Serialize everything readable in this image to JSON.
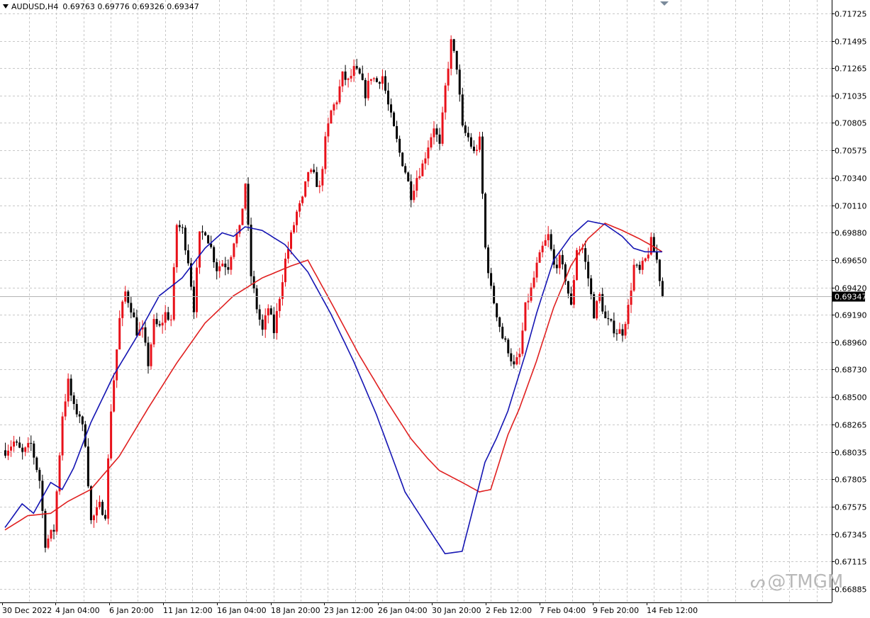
{
  "header": {
    "symbol": "AUDUSD,H4",
    "ohlc": "0.69763 0.69776 0.69326 0.69347"
  },
  "current_price_label": "0.69347",
  "watermark": "@TMGM",
  "icons": {
    "header_dropdown": "triangle-down-icon",
    "watermark_logo": "tmgm-logo-icon",
    "scroll_marker": "triangle-down-icon"
  },
  "colors": {
    "bull_candle": "#e8111a",
    "bear_candle": "#000000",
    "ma_fast": "#1515b3",
    "ma_slow": "#e02020",
    "grid": "#c8c8c8",
    "price_line": "#b4b4b4"
  },
  "chart_data": {
    "type": "candlestick",
    "symbol": "AUDUSD",
    "timeframe": "H4",
    "y_ticks": [
      "0.71725",
      "0.71495",
      "0.71265",
      "0.71035",
      "0.70805",
      "0.70575",
      "0.70340",
      "0.70110",
      "0.69880",
      "0.69650",
      "0.69420",
      "0.69190",
      "0.68960",
      "0.68730",
      "0.68500",
      "0.68265",
      "0.68035",
      "0.67805",
      "0.67575",
      "0.67345",
      "0.67115",
      "0.66885"
    ],
    "x_ticks": [
      "30 Dec 2022",
      "4 Jan 04:00",
      "6 Jan 20:00",
      "11 Jan 12:00",
      "16 Jan 04:00",
      "18 Jan 20:00",
      "23 Jan 12:00",
      "26 Jan 04:00",
      "30 Jan 20:00",
      "2 Feb 12:00",
      "7 Feb 04:00",
      "9 Feb 20:00",
      "14 Feb 12:00"
    ],
    "ylim": [
      0.6683,
      0.718
    ],
    "grid": true,
    "current_price": 0.69347,
    "anchors": [
      [
        0,
        0.6805
      ],
      [
        3,
        0.6812
      ],
      [
        6,
        0.6802
      ],
      [
        9,
        0.681
      ],
      [
        12,
        0.678
      ],
      [
        14,
        0.6727
      ],
      [
        17,
        0.6738
      ],
      [
        20,
        0.6835
      ],
      [
        22,
        0.6862
      ],
      [
        24,
        0.684
      ],
      [
        26,
        0.6835
      ],
      [
        28,
        0.6812
      ],
      [
        30,
        0.6745
      ],
      [
        33,
        0.6758
      ],
      [
        35,
        0.6752
      ],
      [
        37,
        0.684
      ],
      [
        40,
        0.6915
      ],
      [
        42,
        0.6938
      ],
      [
        44,
        0.6925
      ],
      [
        46,
        0.6905
      ],
      [
        48,
        0.6905
      ],
      [
        50,
        0.6878
      ],
      [
        52,
        0.6912
      ],
      [
        54,
        0.6908
      ],
      [
        56,
        0.692
      ],
      [
        58,
        0.6915
      ],
      [
        60,
        0.6995
      ],
      [
        62,
        0.699
      ],
      [
        64,
        0.6965
      ],
      [
        66,
        0.6925
      ],
      [
        68,
        0.6985
      ],
      [
        70,
        0.699
      ],
      [
        72,
        0.6975
      ],
      [
        74,
        0.6958
      ],
      [
        76,
        0.6963
      ],
      [
        78,
        0.696
      ],
      [
        80,
        0.6982
      ],
      [
        82,
        0.699
      ],
      [
        84,
        0.703
      ],
      [
        86,
        0.6952
      ],
      [
        88,
        0.6925
      ],
      [
        90,
        0.6905
      ],
      [
        92,
        0.6925
      ],
      [
        94,
        0.6905
      ],
      [
        96,
        0.6935
      ],
      [
        98,
        0.6965
      ],
      [
        100,
        0.6985
      ],
      [
        102,
        0.7005
      ],
      [
        104,
        0.7015
      ],
      [
        106,
        0.704
      ],
      [
        108,
        0.7035
      ],
      [
        110,
        0.7025
      ],
      [
        112,
        0.7065
      ],
      [
        114,
        0.709
      ],
      [
        116,
        0.71
      ],
      [
        118,
        0.712
      ],
      [
        120,
        0.7115
      ],
      [
        122,
        0.7125
      ],
      [
        124,
        0.712
      ],
      [
        126,
        0.7105
      ],
      [
        128,
        0.712
      ],
      [
        130,
        0.7115
      ],
      [
        132,
        0.712
      ],
      [
        134,
        0.7095
      ],
      [
        136,
        0.7075
      ],
      [
        138,
        0.7055
      ],
      [
        140,
        0.704
      ],
      [
        142,
        0.702
      ],
      [
        144,
        0.7035
      ],
      [
        146,
        0.7045
      ],
      [
        148,
        0.7062
      ],
      [
        150,
        0.7078
      ],
      [
        152,
        0.706
      ],
      [
        154,
        0.711
      ],
      [
        156,
        0.7148
      ],
      [
        158,
        0.7128
      ],
      [
        160,
        0.7075
      ],
      [
        162,
        0.7068
      ],
      [
        164,
        0.7055
      ],
      [
        166,
        0.7065
      ],
      [
        168,
        0.6975
      ],
      [
        170,
        0.694
      ],
      [
        172,
        0.692
      ],
      [
        174,
        0.69
      ],
      [
        176,
        0.689
      ],
      [
        178,
        0.6875
      ],
      [
        180,
        0.6885
      ],
      [
        182,
        0.6925
      ],
      [
        184,
        0.694
      ],
      [
        186,
        0.696
      ],
      [
        188,
        0.6975
      ],
      [
        190,
        0.6985
      ],
      [
        192,
        0.696
      ],
      [
        194,
        0.6965
      ],
      [
        196,
        0.695
      ],
      [
        198,
        0.6925
      ],
      [
        200,
        0.6975
      ],
      [
        202,
        0.6975
      ],
      [
        204,
        0.695
      ],
      [
        206,
        0.692
      ],
      [
        208,
        0.6935
      ],
      [
        210,
        0.6915
      ],
      [
        212,
        0.691
      ],
      [
        214,
        0.6905
      ],
      [
        216,
        0.6905
      ],
      [
        218,
        0.6925
      ],
      [
        220,
        0.696
      ],
      [
        222,
        0.6955
      ],
      [
        224,
        0.6965
      ],
      [
        226,
        0.698
      ],
      [
        228,
        0.6965
      ],
      [
        230,
        0.6935
      ]
    ],
    "ma_fast_anchors": [
      [
        0,
        0.674
      ],
      [
        6,
        0.676
      ],
      [
        10,
        0.6752
      ],
      [
        16,
        0.6778
      ],
      [
        20,
        0.6772
      ],
      [
        24,
        0.679
      ],
      [
        30,
        0.6828
      ],
      [
        38,
        0.6868
      ],
      [
        46,
        0.69
      ],
      [
        54,
        0.6935
      ],
      [
        62,
        0.695
      ],
      [
        70,
        0.6975
      ],
      [
        76,
        0.6988
      ],
      [
        80,
        0.6985
      ],
      [
        84,
        0.6993
      ],
      [
        90,
        0.699
      ],
      [
        98,
        0.6978
      ],
      [
        106,
        0.6955
      ],
      [
        114,
        0.692
      ],
      [
        122,
        0.688
      ],
      [
        130,
        0.6835
      ],
      [
        140,
        0.677
      ],
      [
        148,
        0.674
      ],
      [
        154,
        0.6718
      ],
      [
        160,
        0.672
      ],
      [
        168,
        0.6795
      ],
      [
        172,
        0.6815
      ],
      [
        176,
        0.6838
      ],
      [
        182,
        0.6885
      ],
      [
        186,
        0.692
      ],
      [
        192,
        0.6965
      ],
      [
        198,
        0.6985
      ],
      [
        204,
        0.6998
      ],
      [
        210,
        0.6995
      ],
      [
        216,
        0.6985
      ],
      [
        220,
        0.6975
      ],
      [
        224,
        0.6972
      ],
      [
        228,
        0.6972
      ],
      [
        230,
        0.6972
      ]
    ],
    "ma_slow_anchors": [
      [
        0,
        0.6738
      ],
      [
        8,
        0.675
      ],
      [
        16,
        0.6752
      ],
      [
        22,
        0.6762
      ],
      [
        30,
        0.6772
      ],
      [
        40,
        0.68
      ],
      [
        50,
        0.684
      ],
      [
        60,
        0.6878
      ],
      [
        70,
        0.6912
      ],
      [
        80,
        0.6935
      ],
      [
        90,
        0.695
      ],
      [
        100,
        0.696
      ],
      [
        106,
        0.6965
      ],
      [
        114,
        0.693
      ],
      [
        124,
        0.6885
      ],
      [
        134,
        0.6845
      ],
      [
        142,
        0.6815
      ],
      [
        148,
        0.6798
      ],
      [
        152,
        0.6788
      ],
      [
        160,
        0.6778
      ],
      [
        166,
        0.677
      ],
      [
        170,
        0.6772
      ],
      [
        176,
        0.6818
      ],
      [
        180,
        0.684
      ],
      [
        186,
        0.688
      ],
      [
        192,
        0.6925
      ],
      [
        198,
        0.696
      ],
      [
        204,
        0.6983
      ],
      [
        210,
        0.6996
      ],
      [
        216,
        0.699
      ],
      [
        222,
        0.6983
      ],
      [
        228,
        0.6975
      ],
      [
        230,
        0.6972
      ]
    ]
  }
}
